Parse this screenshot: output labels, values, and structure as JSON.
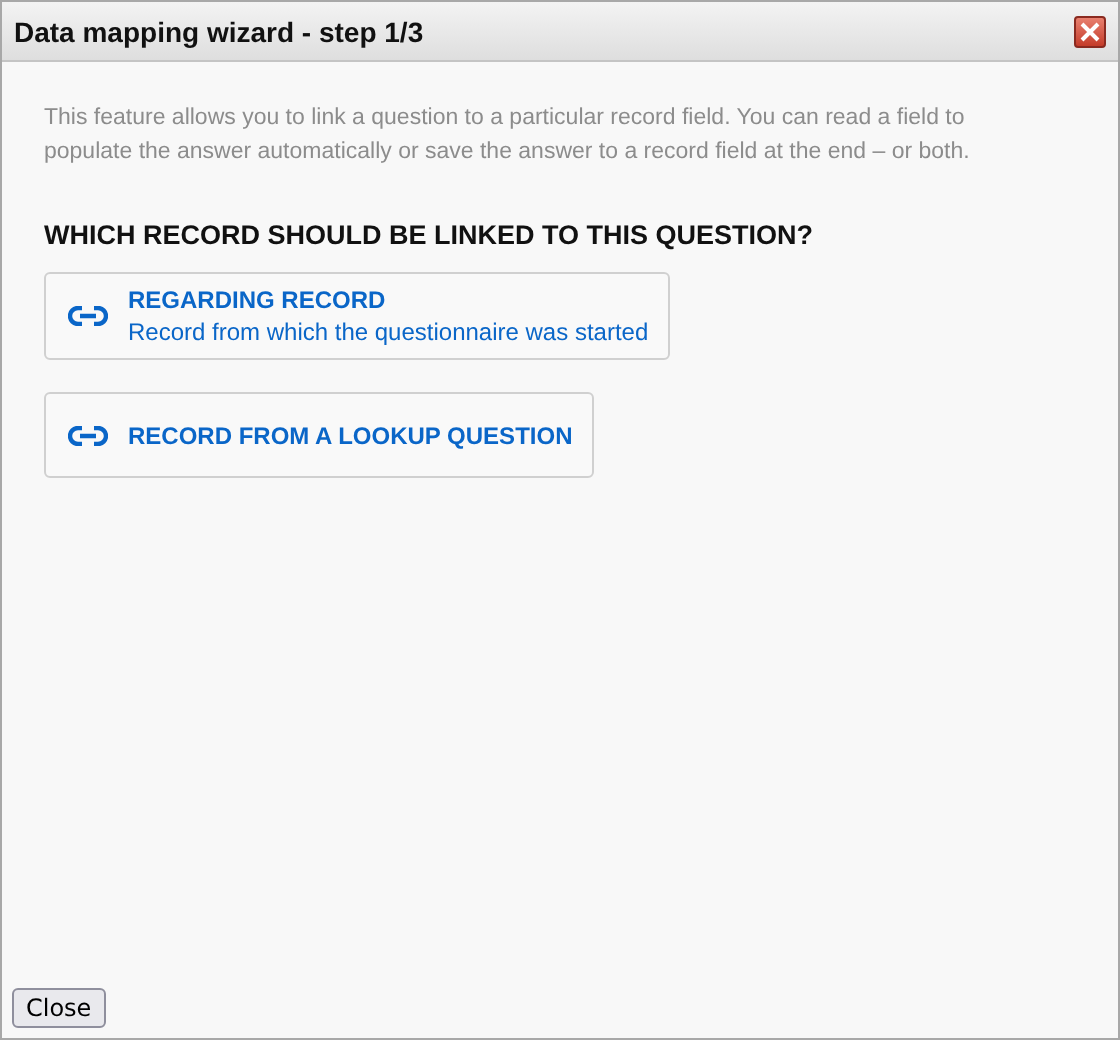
{
  "window": {
    "title": "Data mapping wizard - step 1/3"
  },
  "description": "This feature allows you to link a question to a particular record field. You can read a field to populate the answer automatically or save the answer to a record field at the end – or both.",
  "heading": "WHICH RECORD SHOULD BE LINKED TO THIS QUESTION?",
  "options": [
    {
      "title": "REGARDING RECORD",
      "subtitle": "Record from which the questionnaire was started"
    },
    {
      "title": "RECORD FROM A LOOKUP QUESTION"
    }
  ],
  "buttons": [
    "Close"
  ]
}
